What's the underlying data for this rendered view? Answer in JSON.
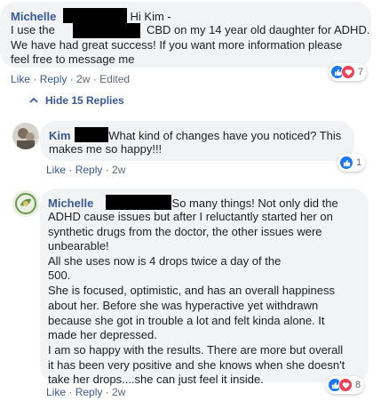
{
  "comment1": {
    "author": "Michelle",
    "lines": [
      "Hi Kim -",
      "I use the",
      "CBD on my 14 year old daughter for ADHD.",
      "We have had great success! If you want more information please",
      "feel free to message me"
    ],
    "actions": {
      "like": "Like",
      "reply": "Reply",
      "time": "2w",
      "edited": "Edited"
    },
    "reactions": {
      "count": "7"
    }
  },
  "hide_replies": {
    "label": "Hide 15 Replies"
  },
  "reply1": {
    "author": "Kim",
    "lines": [
      "What kind of changes have you noticed? This",
      "makes me so happy!!!"
    ],
    "actions": {
      "like": "Like",
      "reply": "Reply",
      "time": "2w"
    },
    "reactions": {
      "count": "1"
    }
  },
  "reply2": {
    "author": "Michelle",
    "lines": [
      "So many things! Not only did the",
      "ADHD cause issues but after I reluctantly started her on",
      "synthetic drugs from the doctor, the other issues were",
      "unbearable!",
      "All she uses now is 4 drops twice a day of the",
      "500.",
      "She is focused, optimistic, and has an overall happiness",
      "about her. Before she was hyperactive yet withdrawn",
      "because she got in trouble a lot and felt kinda alone. It",
      "made her depressed.",
      "I am so happy with the results. There are more but overall",
      "it has been very positive and she knows when she doesn't",
      "take her drops....she can just feel it inside."
    ],
    "actions": {
      "like": "Like",
      "reply": "Reply",
      "time": "2w"
    },
    "reactions": {
      "count": "8"
    }
  },
  "colors": {
    "link": "#385898",
    "bubble": "#f2f3f5",
    "like": "#1877f2",
    "love": "#f33e58"
  }
}
